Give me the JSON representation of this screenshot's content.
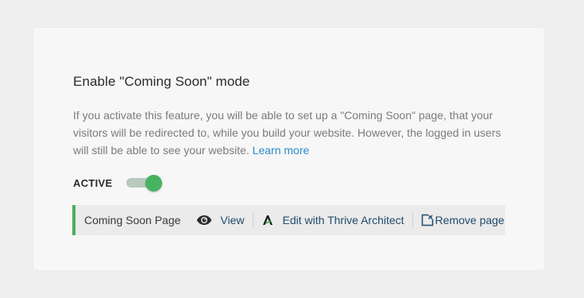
{
  "section": {
    "title": "Enable \"Coming Soon\" mode",
    "description": "If you activate this feature, you will be able to set up a \"Coming Soon\" page, that your visitors will be redirected to, while you build your website. However, the logged in users will still be able to see your website.",
    "learn_more": "Learn more"
  },
  "status": {
    "label": "ACTIVE",
    "enabled": true
  },
  "page_bar": {
    "page_name": "Coming Soon Page",
    "view_label": "View",
    "edit_label": "Edit with Thrive Architect",
    "remove_label": "Remove page"
  },
  "colors": {
    "accent_green": "#4caf5b",
    "toggle_knob": "#47b25f",
    "link_blue": "#2d8ac7",
    "action_text": "#1f4a6b"
  },
  "icons": {
    "view": "eye-icon",
    "edit": "thrive-architect-icon",
    "remove": "remove-page-icon"
  }
}
